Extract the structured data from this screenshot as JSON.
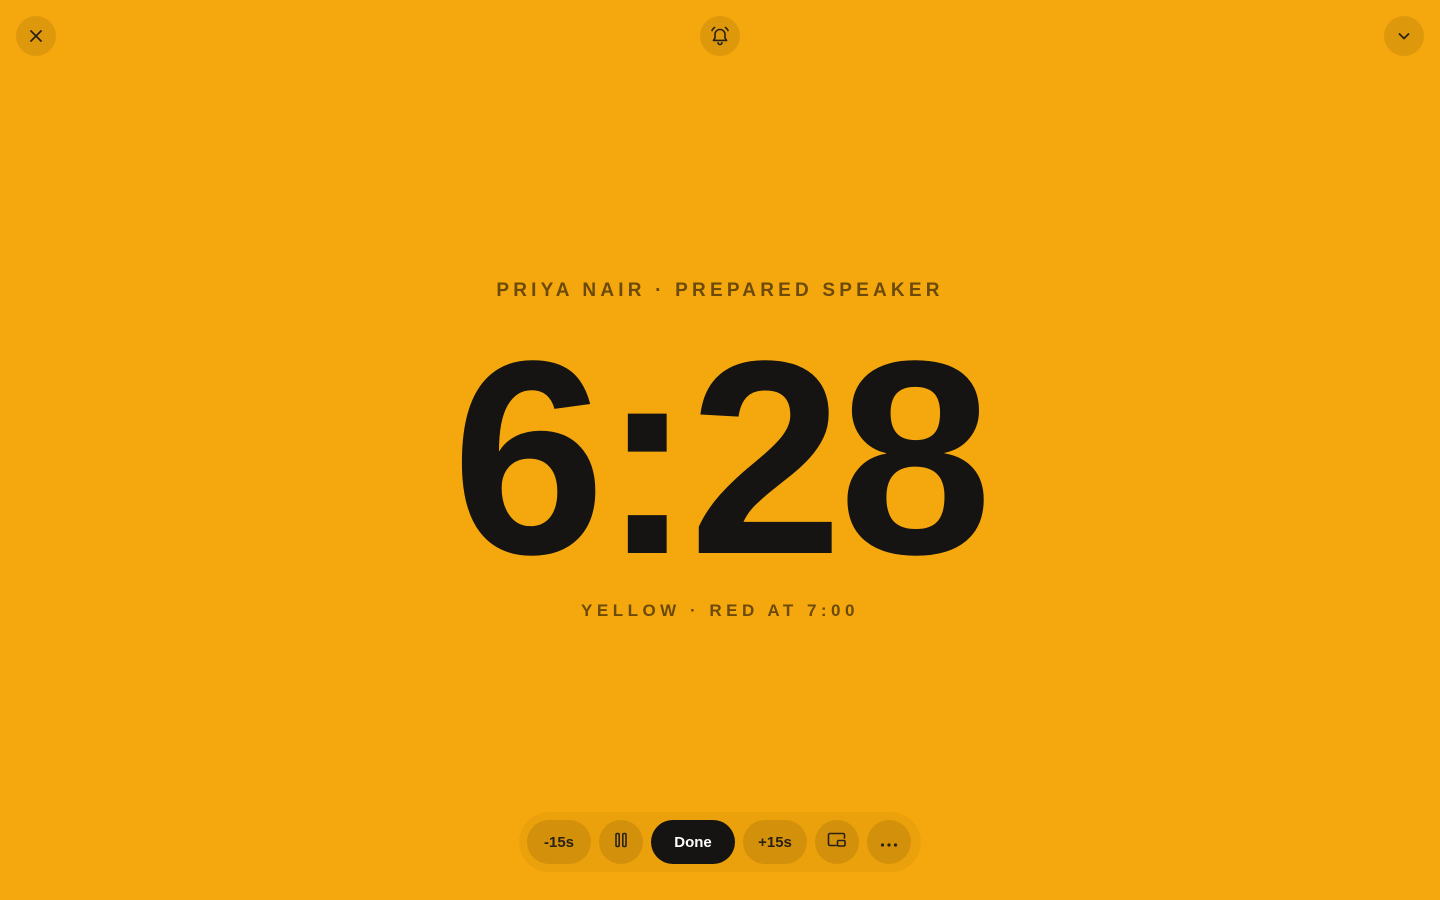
{
  "header": {
    "close_icon": "close-icon",
    "bell_icon": "bell-icon",
    "collapse_icon": "chevron-down-icon"
  },
  "speaker": {
    "line": "PRIYA NAIR · PREPARED SPEAKER"
  },
  "timer": {
    "display": "6:28"
  },
  "status": {
    "line": "YELLOW · RED AT 7:00"
  },
  "controls": {
    "minus_label": "-15s",
    "pause_icon": "pause-icon",
    "done_label": "Done",
    "plus_label": "+15s",
    "pip_icon": "picture-in-picture-icon",
    "more_icon": "more-horizontal-icon"
  },
  "colors": {
    "background": "#F5A80D",
    "timer_text": "#151412",
    "label_text": "#6B4A0A",
    "done_button": "#151412"
  }
}
